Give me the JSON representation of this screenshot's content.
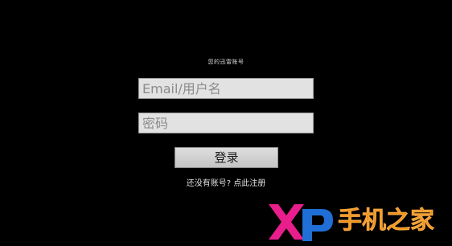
{
  "login": {
    "header": "您的迅雷账号",
    "email_placeholder": "Email/用户名",
    "password_placeholder": "密码",
    "login_label": "登录",
    "register_link": "还没有账号? 点此注册"
  },
  "watermark": {
    "logo_text": "XP手机之家",
    "colors": {
      "x": "#e81e8c",
      "p": "#1f6fd6",
      "text": "#f08a00"
    }
  }
}
